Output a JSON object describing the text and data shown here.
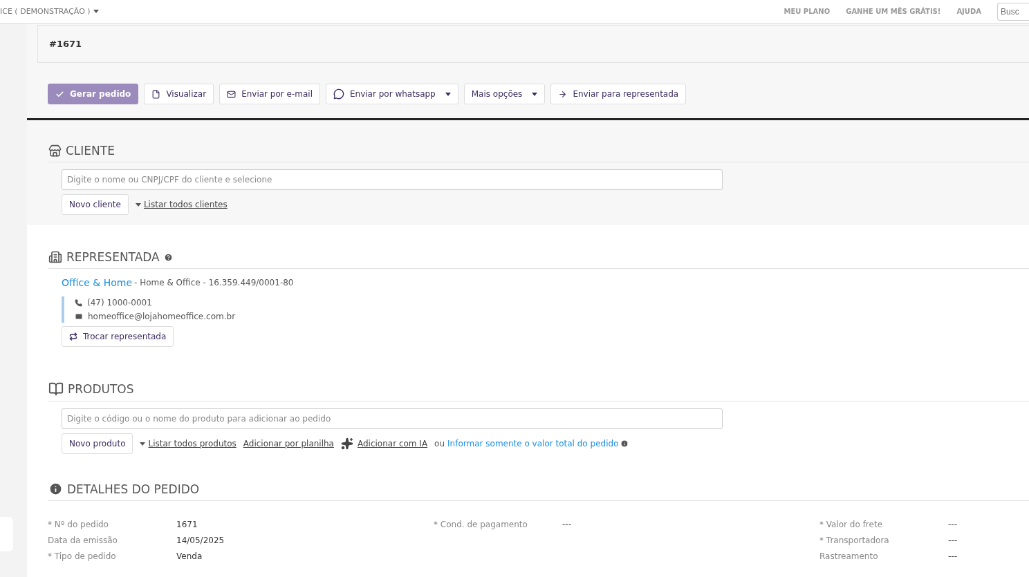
{
  "header": {
    "account": "ICE ( DEMONSTRAÇÃO )",
    "links": [
      "MEU PLANO",
      "GANHE UM MÊS GRÁTIS!",
      "AJUDA"
    ],
    "search": {
      "placeholder": "Busc"
    }
  },
  "order": {
    "number": "#1671"
  },
  "actions": [
    {
      "label": "Gerar pedido",
      "kind": "confirm",
      "primary": true,
      "dropdown": false
    },
    {
      "label": "Visualizar",
      "kind": "preview",
      "primary": false,
      "dropdown": false
    },
    {
      "label": "Enviar por e-mail",
      "kind": "email",
      "primary": false,
      "dropdown": false
    },
    {
      "label": "Enviar por whatsapp",
      "kind": "chat",
      "primary": false,
      "dropdown": true
    },
    {
      "label": "Mais opções",
      "kind": "menu",
      "primary": false,
      "dropdown": true
    },
    {
      "label": "Enviar para representada",
      "kind": "forward",
      "primary": false,
      "dropdown": false
    }
  ],
  "client": {
    "title": "CLIENTE",
    "search": {
      "placeholder": "Digite o nome ou CNPJ/CPF do cliente e selecione"
    },
    "new_button": "Novo cliente",
    "list_link": "Listar todos clientes"
  },
  "representada": {
    "title": "REPRESENTADA",
    "name": "Office & Home",
    "details": "- Home & Office - 16.359.449/0001-80",
    "phone": "(47) 1000-0001",
    "email": "homeoffice@lojahomeoffice.com.br",
    "button": "Trocar representada"
  },
  "produtos": {
    "title": "PRODUTOS",
    "search": {
      "placeholder": "Digite o código ou o nome do produto para adicionar ao pedido"
    },
    "new_button": "Novo produto",
    "links": [
      {
        "label": "Listar todos produtos",
        "kind": "caret"
      },
      {
        "label": "Adicionar por planilha",
        "kind": "plain"
      },
      {
        "label": "Adicionar com IA",
        "kind": "sparkle"
      }
    ],
    "or_text": "ou",
    "total_link": "Informar somente o valor total do pedido"
  },
  "detalhes": {
    "title": "DETALHES DO PEDIDO",
    "columns": [
      [
        {
          "label": "* Nº do pedido",
          "value": "1671"
        },
        {
          "label": "Data da emissão",
          "value": "14/05/2025"
        },
        {
          "label": "* Tipo de pedido",
          "value": "Venda"
        }
      ],
      [
        {
          "label": "* Cond. de pagamento",
          "value": "---"
        }
      ],
      [
        {
          "label": "* Valor do frete",
          "value": "---"
        },
        {
          "label": "* Transportadora",
          "value": "---"
        },
        {
          "label": "Rastreamento",
          "value": "---"
        }
      ]
    ]
  }
}
